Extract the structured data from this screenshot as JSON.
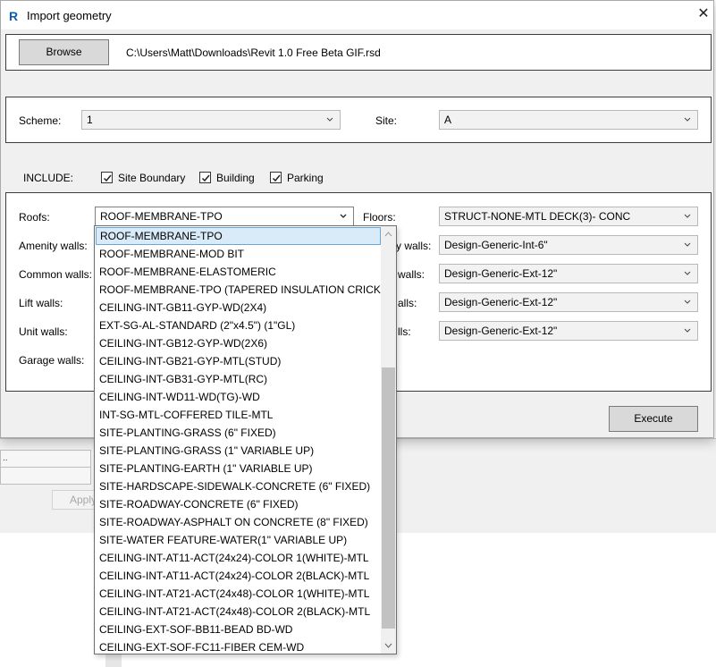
{
  "dialog": {
    "title": "Import geometry",
    "close_icon": "close-icon",
    "app_icon": "revit-logo"
  },
  "file": {
    "browse_label": "Browse",
    "path": "C:\\Users\\Matt\\Downloads\\Revit 1.0 Free Beta GIF.rsd"
  },
  "scheme": {
    "label": "Scheme:",
    "value": "1"
  },
  "site": {
    "label": "Site:",
    "value": "A"
  },
  "include": {
    "label": "INCLUDE:",
    "options": [
      {
        "label": "Site Boundary",
        "checked": true
      },
      {
        "label": "Building",
        "checked": true
      },
      {
        "label": "Parking",
        "checked": true
      }
    ]
  },
  "materials": {
    "left": [
      {
        "label": "Roofs:",
        "value": "ROOF-MEMBRANE-TPO"
      },
      {
        "label": "Amenity walls:"
      },
      {
        "label": "Common walls:"
      },
      {
        "label": "Lift walls:"
      },
      {
        "label": "Unit walls:"
      },
      {
        "label": "Garage walls:"
      }
    ],
    "right": [
      {
        "label": "Floors:",
        "value": "STRUCT-NONE-MTL DECK(3)- CONC"
      },
      {
        "label": "y walls:",
        "value": "Design-Generic-Int-6\""
      },
      {
        "label": "walls:",
        "value": "Design-Generic-Ext-12\""
      },
      {
        "label": "alls:",
        "value": "Design-Generic-Ext-12\""
      },
      {
        "label": "lls:",
        "value": "Design-Generic-Ext-12\""
      }
    ]
  },
  "dropdown": {
    "selected_index": 0,
    "items": [
      "ROOF-MEMBRANE-TPO",
      "ROOF-MEMBRANE-MOD BIT",
      "ROOF-MEMBRANE-ELASTOMERIC",
      "ROOF-MEMBRANE-TPO (TAPERED INSULATION CRICKETS)",
      "CEILING-INT-GB11-GYP-WD(2X4)",
      "EXT-SG-AL-STANDARD (2\"x4.5\") (1\"GL)",
      "CEILING-INT-GB12-GYP-WD(2X6)",
      "CEILING-INT-GB21-GYP-MTL(STUD)",
      "CEILING-INT-GB31-GYP-MTL(RC)",
      "CEILING-INT-WD11-WD(TG)-WD",
      "INT-SG-MTL-COFFERED TILE-MTL",
      "SITE-PLANTING-GRASS (6\" FIXED)",
      "SITE-PLANTING-GRASS (1\" VARIABLE UP)",
      "SITE-PLANTING-EARTH (1\" VARIABLE UP)",
      "SITE-HARDSCAPE-SIDEWALK-CONCRETE (6\" FIXED)",
      "SITE-ROADWAY-CONCRETE (6\" FIXED)",
      "SITE-ROADWAY-ASPHALT ON CONCRETE (8\" FIXED)",
      "SITE-WATER FEATURE-WATER(1\" VARIABLE UP)",
      "CEILING-INT-AT11-ACT(24x24)-COLOR 1(WHITE)-MTL",
      "CEILING-INT-AT11-ACT(24x24)-COLOR 2(BLACK)-MTL",
      "CEILING-INT-AT21-ACT(24x48)-COLOR 1(WHITE)-MTL",
      "CEILING-INT-AT21-ACT(24x48)-COLOR 2(BLACK)-MTL",
      "CEILING-EXT-SOF-BB11-BEAD BD-WD",
      "CEILING-EXT-SOF-FC11-FIBER CEM-WD"
    ]
  },
  "execute_label": "Execute",
  "background": {
    "field_text": "..",
    "apply_label": "Apply"
  },
  "colors": {
    "accent": "#0a5fb4",
    "selection": "#d9ebf9",
    "selection_border": "#6aa6d6"
  }
}
